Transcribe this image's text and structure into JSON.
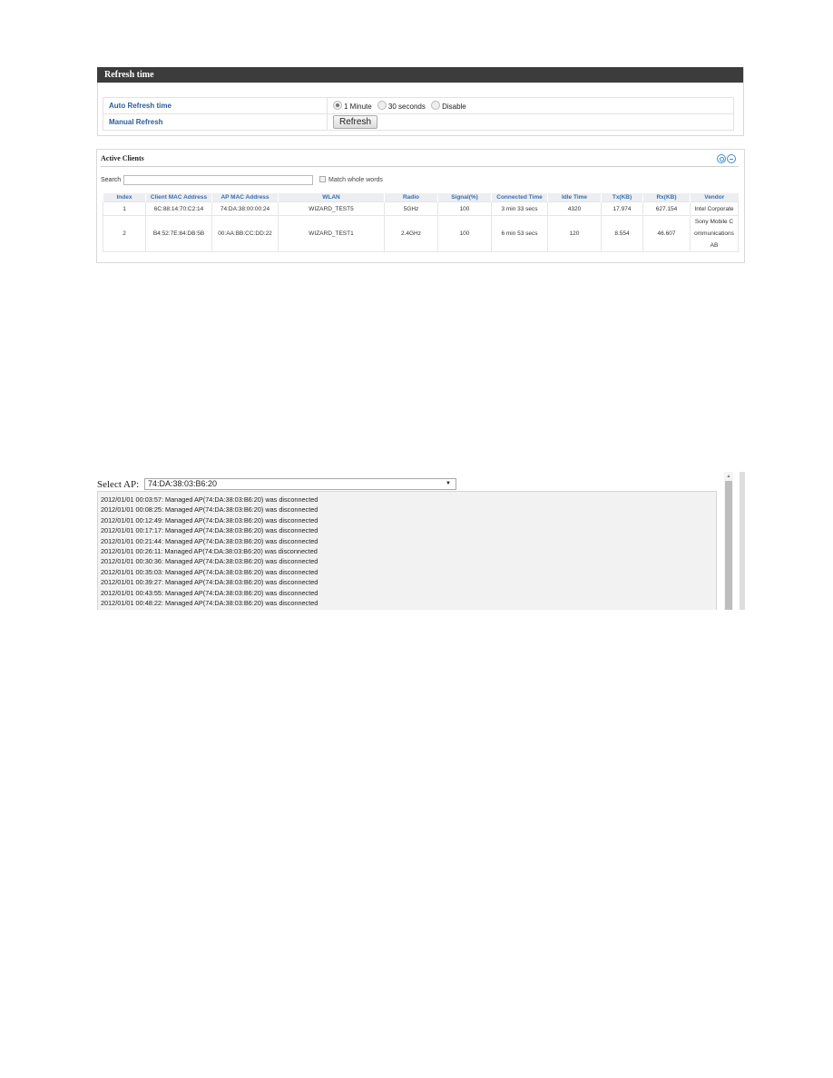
{
  "refresh_time": {
    "title": "Refresh time",
    "auto_refresh_label": "Auto Refresh time",
    "options": [
      {
        "label": "1 Minute",
        "checked": true
      },
      {
        "label": "30 seconds",
        "checked": false
      },
      {
        "label": "Disable",
        "checked": false
      }
    ],
    "manual_refresh_label": "Manual Refresh",
    "refresh_button": "Refresh"
  },
  "active_clients": {
    "title": "Active Clients",
    "search_label": "Search",
    "search_value": "",
    "match_whole_words_label": "Match whole words",
    "columns": [
      "Index",
      "Client MAC Address",
      "AP MAC Address",
      "WLAN",
      "Radio",
      "Signal(%)",
      "Connected Time",
      "Idle Time",
      "Tx(KB)",
      "Rx(KB)",
      "Vendor"
    ],
    "rows": [
      [
        "1",
        "6C:88:14:70:C2:14",
        "74:DA:38:00:00:24",
        "WIZARD_TEST5",
        "5GHz",
        "100",
        "3 min 33 secs",
        "4320",
        "17.974",
        "627.154",
        "Intel Corporate"
      ],
      [
        "2",
        "B4:52:7E:84:DB:5B",
        "00:AA:BB:CC:DD:22",
        "WIZARD_TEST1",
        "2.4GHz",
        "100",
        "6 min 53 secs",
        "120",
        "8.554",
        "46.607",
        "Sony Mobile C ommunications AB"
      ]
    ]
  },
  "log_viewer": {
    "select_label": "Select AP:",
    "selected_ap": "74:DA:38:03:B6:20",
    "lines": [
      "2012/01/01 00:03:57: Managed AP(74:DA:38:03:B6:20) was disconnected",
      "2012/01/01 00:08:25: Managed AP(74:DA:38:03:B6:20) was disconnected",
      "2012/01/01 00:12:49: Managed AP(74:DA:38:03:B6:20) was disconnected",
      "2012/01/01 00:17:17: Managed AP(74:DA:38:03:B6:20) was disconnected",
      "2012/01/01 00:21:44: Managed AP(74:DA:38:03:B6:20) was disconnected",
      "2012/01/01 00:26:11: Managed AP(74:DA:38:03:B6:20) was disconnected",
      "2012/01/01 00:30:36: Managed AP(74:DA:38:03:B6:20) was disconnected",
      "2012/01/01 00:35:03: Managed AP(74:DA:38:03:B6:20) was disconnected",
      "2012/01/01 00:39:27: Managed AP(74:DA:38:03:B6:20) was disconnected",
      "2012/01/01 00:43:55: Managed AP(74:DA:38:03:B6:20) was disconnected",
      "2012/01/01 00:48:22: Managed AP(74:DA:38:03:B6:20) was disconnected"
    ]
  }
}
